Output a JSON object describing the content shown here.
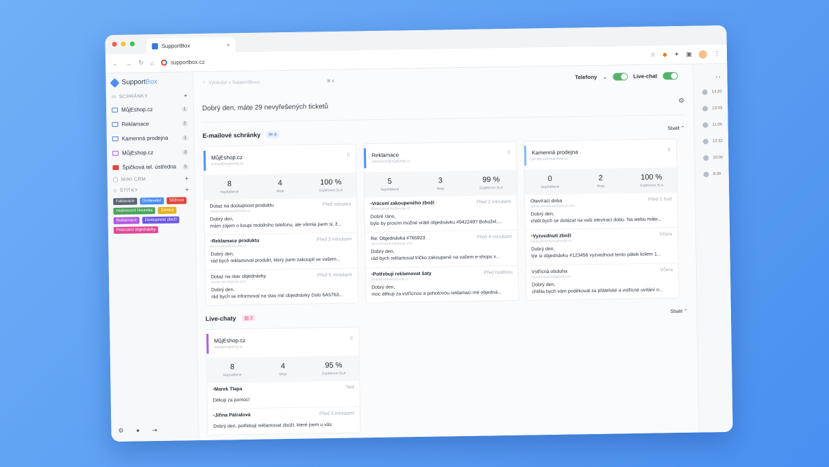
{
  "browser": {
    "tab_title": "SupportBox",
    "tab_close": "×",
    "url": "supportbox.cz"
  },
  "sidebar": {
    "logo_a": "Support",
    "logo_b": "Box",
    "mailboxes_heading": "SCHRÁNKY",
    "mailboxes": [
      {
        "label": "MůjEshop.cz",
        "count": "1"
      },
      {
        "label": "Reklamace",
        "count": "2"
      },
      {
        "label": "Kamenná prodejna",
        "count": "1"
      },
      {
        "label": "MůjEshop.cz",
        "count": "3"
      },
      {
        "label": "Špičková tel. ústředna",
        "count": "5"
      }
    ],
    "crm_heading": "MINI CRM",
    "tags_heading": "ŠTÍTKY",
    "tags": [
      {
        "label": "Fakturace",
        "color": "#5a6472"
      },
      {
        "label": "Dodavatel",
        "color": "#4b8ef0"
      },
      {
        "label": "Stížnost",
        "color": "#e0433a"
      },
      {
        "label": "Hodnocení Heureka",
        "color": "#4aa35a"
      },
      {
        "label": "Záruka",
        "color": "#e6b31a"
      },
      {
        "label": "Reklamace",
        "color": "#b35ae0"
      },
      {
        "label": "Dostupnost zboží",
        "color": "#6a5ae0"
      },
      {
        "label": "Potvrzení objednávky",
        "color": "#e04a9a"
      }
    ]
  },
  "topbar": {
    "search_placeholder": "Vyhledat v SupportBoxu",
    "search_kbd": "⌘ K",
    "phones_label": "Telefony",
    "livechat_label": "Live-chat"
  },
  "main": {
    "greeting": "Dobrý den, máte 29 nevyřešených ticketů",
    "email_section": {
      "title": "E-mailové schránky",
      "count": "4",
      "collapse": "Sbalit"
    },
    "chat_section": {
      "title": "Live-chaty",
      "count": "3",
      "collapse": "Sbalit"
    },
    "stat_labels": {
      "unresolved": "Nepřidělené",
      "mine": "Moje",
      "sla": "Úspěšnost SLA"
    },
    "email_cards": [
      {
        "name": "MůjEshop.cz",
        "email": "eshop@mujeshop.cz",
        "color": "#4b8ef0",
        "stats": [
          "8",
          "4",
          "100 %"
        ],
        "messages": [
          {
            "subject": "Dotaz na dostupnost produktu",
            "from": "marie.novakova@email.cz",
            "time": "Před minutou",
            "greeting": "Dobrý den,",
            "body": "mám zájem o koupi mobilního telefonu, ale všimla jsem si, ž...",
            "bold": false
          },
          {
            "subject": "Reklamace produktu",
            "from": "jiri.novotny@seznam.cz",
            "time": "Před 3 minutami",
            "greeting": "Dobrý den,",
            "body": "rád bych reklamoval produkt, který jsem zakoupil ve vašem...",
            "bold": true
          },
          {
            "subject": "Dotaz na stav objednávky",
            "from": "novak.petr@gmail.com",
            "time": "Před 5 minutami",
            "greeting": "Dobrý den,",
            "body": "rád bych se informoval na stav mé objednávky číslo 6A5763...",
            "bold": false
          }
        ]
      },
      {
        "name": "Reklamace",
        "email": "reklamace@mujeshop.cz",
        "color": "#4b8ef0",
        "stats": [
          "5",
          "3",
          "99 %"
        ],
        "messages": [
          {
            "subject": "Vrácení zakoupeného zboží",
            "from": "simon.cervenka@email.cz",
            "time": "Před 2 minutami",
            "greeting": "Dobré ráno,",
            "body": "bylo by prosím možné vrátit objednávku #942249? Bohužel,...",
            "bold": true
          },
          {
            "subject": "Re: Objednávka #765923",
            "from": "vera.strnadova@gmail.com",
            "time": "Před 4 minutami",
            "greeting": "Dobrý den,",
            "body": "rád bych reklamoval tričko zakoupené na vašem e-shopu v...",
            "bold": false
          },
          {
            "subject": "Potřebuji reklamovat šaty",
            "from": "jana.kovarova@email.cz",
            "time": "Před hodinou",
            "greeting": "Dobrý den,",
            "body": "moc děkuji za vstřícnou a pohotovou reklamaci mé objedná...",
            "bold": true
          }
        ]
      },
      {
        "name": "Kamenná prodejna",
        "email": "prodejna@mujeshop.cz",
        "color": "#8bb8f5",
        "stats": [
          "0",
          "2",
          "100 %"
        ],
        "messages": [
          {
            "subject": "Otevírací doba",
            "from": "adela.dvorakova@gmail.com",
            "time": "Před 1 hod",
            "greeting": "Dobrý den,",
            "body": "chtěl bych se dotázat na vaši otevírací dobu. Na webu máte...",
            "bold": false
          },
          {
            "subject": "Vyzvednutí zboží",
            "from": "lukas.prochazka@email.cz",
            "time": "Včera",
            "greeting": "Dobrý den,",
            "body": "lze si objednávku #123456 vyzvednout tento pátek kolem 1...",
            "bold": true
          },
          {
            "subject": "Vstřícná obsluha",
            "from": "eva.horakova@gmail.com",
            "time": "Včera",
            "greeting": "Dobrý den,",
            "body": "chtěla bych vám poděkovat za přátelské a vstřícné uvítání n...",
            "bold": false
          }
        ]
      }
    ],
    "chat_card": {
      "name": "MůjEshop.cz",
      "email": "web@mujeshop.cz",
      "color": "#b35ae0",
      "stats": [
        "8",
        "4",
        "95 %"
      ],
      "messages": [
        {
          "subject": "Marek Tlapa",
          "from": "",
          "time": "Teď",
          "greeting": "Děkuji za pomoc!",
          "body": "",
          "bold": true
        },
        {
          "subject": "Jiřina Pátralová",
          "from": "",
          "time": "Před 3 minutami",
          "greeting": "Dobrý den, potřebuji reklamovat zboží, které jsem u vás",
          "body": "",
          "bold": true
        }
      ]
    }
  },
  "rail": {
    "collapse": "› ›",
    "times": [
      "14:20",
      "13:03",
      "11:05",
      "10:32",
      "10:05",
      "9:30"
    ]
  }
}
